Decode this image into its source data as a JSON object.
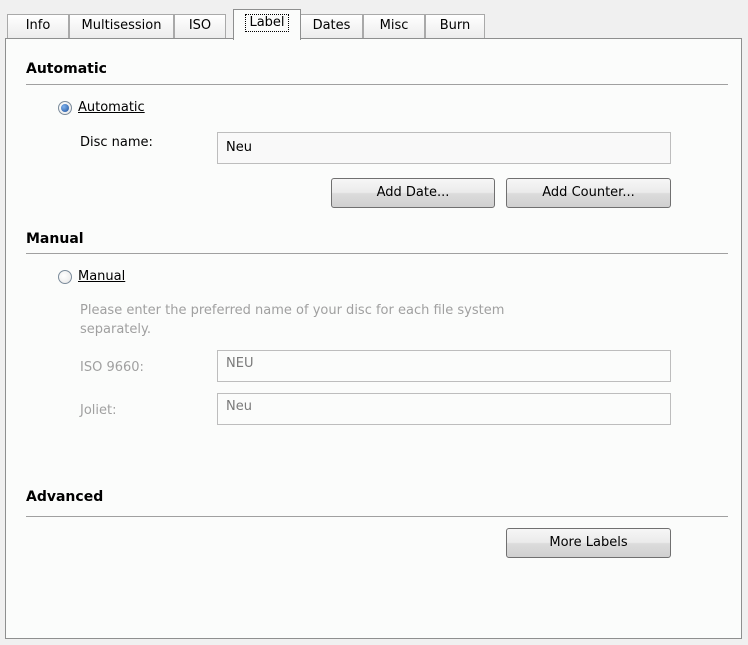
{
  "tabs": [
    "Info",
    "Multisession",
    "ISO",
    "Label",
    "Dates",
    "Misc",
    "Burn"
  ],
  "active_tab": "Label",
  "automatic": {
    "section_title": "Automatic",
    "radio_label": "Automatic",
    "radio_selected": true,
    "disc_name_label": "Disc name:",
    "disc_name_value": "Neu",
    "add_date_button": "Add Date...",
    "add_counter_button": "Add Counter..."
  },
  "manual": {
    "section_title": "Manual",
    "radio_label": "Manual",
    "radio_selected": false,
    "hint_line1": "Please enter the preferred name of your disc for each file system",
    "hint_line2": "separately.",
    "iso_label": "ISO 9660:",
    "iso_value": "NEU",
    "joliet_label": "Joliet:",
    "joliet_value": "Neu"
  },
  "advanced": {
    "section_title": "Advanced",
    "more_labels_button": "More Labels"
  }
}
